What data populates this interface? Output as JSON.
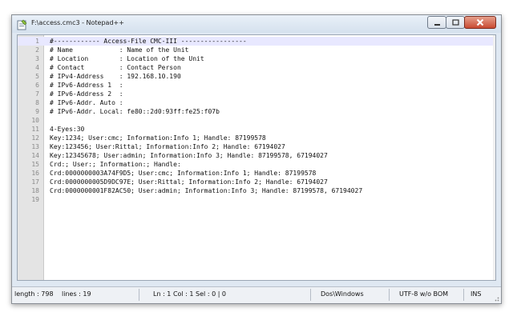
{
  "window": {
    "title": "F:\\access.cmc3 - Notepad++"
  },
  "colors": {
    "title_gradient_top": "#e9f0f8",
    "close_button": "#c94a32",
    "current_line": "#e8e8ff"
  },
  "editor": {
    "lines": [
      {
        "n": "1",
        "text": "#------------ Access-File CMC-III -----------------"
      },
      {
        "n": "2",
        "text": "# Name            : Name of the Unit"
      },
      {
        "n": "3",
        "text": "# Location        : Location of the Unit"
      },
      {
        "n": "4",
        "text": "# Contact         : Contact Person"
      },
      {
        "n": "5",
        "text": "# IPv4-Address    : 192.168.10.190"
      },
      {
        "n": "6",
        "text": "# IPv6-Address 1  :"
      },
      {
        "n": "7",
        "text": "# IPv6-Address 2  :"
      },
      {
        "n": "8",
        "text": "# IPv6-Addr. Auto :"
      },
      {
        "n": "9",
        "text": "# IPv6-Addr. Local: fe80::2d0:93ff:fe25:f07b"
      },
      {
        "n": "10",
        "text": ""
      },
      {
        "n": "11",
        "text": "4-Eyes:30"
      },
      {
        "n": "12",
        "text": "Key:1234; User:cmc; Information:Info 1; Handle: 87199578"
      },
      {
        "n": "13",
        "text": "Key:123456; User:Rittal; Information:Info 2; Handle: 67194027"
      },
      {
        "n": "14",
        "text": "Key:12345678; User:admin; Information:Info 3; Handle: 87199578, 67194027"
      },
      {
        "n": "15",
        "text": "Crd:; User:; Information:; Handle:"
      },
      {
        "n": "16",
        "text": "Crd:0000000003A74F9D5; User:cmc; Information:Info 1; Handle: 87199578"
      },
      {
        "n": "17",
        "text": "Crd:0000000005D9DC97E; User:Rittal; Information:Info 2; Handle: 67194027"
      },
      {
        "n": "18",
        "text": "Crd:0000000001F82AC50; User:admin; Information:Info 3; Handle: 87199578, 67194027"
      },
      {
        "n": "19",
        "text": ""
      }
    ]
  },
  "status": {
    "length": "length : 798",
    "lines": "lines : 19",
    "position": "Ln : 1    Col : 1    Sel : 0 | 0",
    "eol": "Dos\\Windows",
    "encoding": "UTF-8 w/o BOM",
    "mode": "INS"
  }
}
